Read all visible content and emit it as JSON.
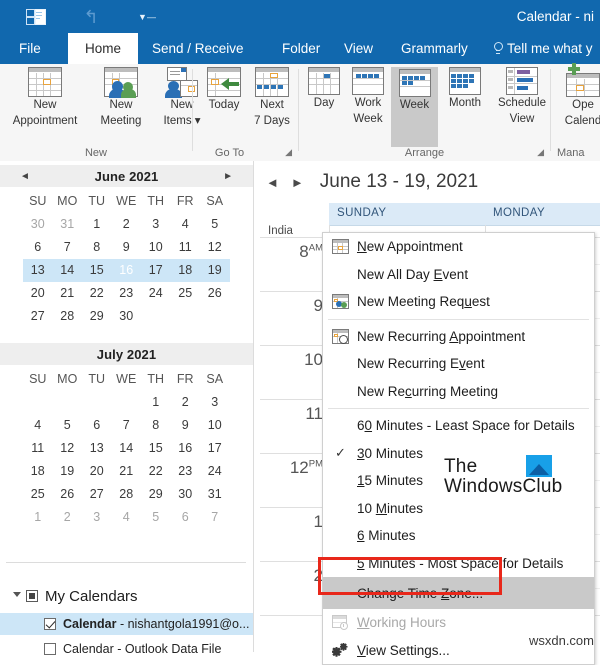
{
  "window": {
    "title": "Calendar - ni",
    "quick_access": [
      {
        "name": "outlook-icon",
        "label": "Outlook"
      },
      {
        "name": "undo-icon",
        "label": "Undo"
      },
      {
        "name": "customize-qat-icon",
        "label": "Customize Quick Access Toolbar"
      }
    ],
    "accent_color": "#1168ae"
  },
  "tabs": [
    {
      "label": "File",
      "active": false
    },
    {
      "label": "Home",
      "active": true
    },
    {
      "label": "Send / Receive",
      "active": false
    },
    {
      "label": "Folder",
      "active": false
    },
    {
      "label": "View",
      "active": false
    },
    {
      "label": "Grammarly",
      "active": false
    }
  ],
  "tell_me": "Tell me what y",
  "ribbon": {
    "groups": [
      {
        "name": "New",
        "label": "New",
        "has_launcher": false,
        "buttons": [
          {
            "label_line1": "New",
            "label_line2": "Appointment",
            "icon": "new-appointment-icon"
          },
          {
            "label_line1": "New",
            "label_line2": "Meeting",
            "icon": "new-meeting-icon"
          },
          {
            "label_line1": "New",
            "label_line2": "Items ▾",
            "icon": "new-items-icon"
          }
        ]
      },
      {
        "name": "GoTo",
        "label": "Go To",
        "has_launcher": true,
        "buttons": [
          {
            "label_line1": "Today",
            "label_line2": "",
            "icon": "today-icon"
          },
          {
            "label_line1": "Next",
            "label_line2": "7 Days",
            "icon": "next-7-days-icon"
          }
        ]
      },
      {
        "name": "Arrange",
        "label": "Arrange",
        "has_launcher": true,
        "buttons": [
          {
            "label_line1": "Day",
            "label_line2": "",
            "icon": "day-view-icon",
            "selected": false
          },
          {
            "label_line1": "Work",
            "label_line2": "Week",
            "icon": "work-week-icon",
            "selected": false
          },
          {
            "label_line1": "Week",
            "label_line2": "",
            "icon": "week-view-icon",
            "selected": true
          },
          {
            "label_line1": "Month",
            "label_line2": "",
            "icon": "month-view-icon",
            "selected": false
          },
          {
            "label_line1": "Schedule",
            "label_line2": "View",
            "icon": "schedule-view-icon",
            "selected": false
          }
        ]
      },
      {
        "name": "Manage",
        "label": "Mana",
        "has_launcher": false,
        "buttons": [
          {
            "label_line1": "Ope",
            "label_line2": "Calend",
            "icon": "open-calendar-icon"
          }
        ]
      }
    ]
  },
  "date_navigator": {
    "months": [
      {
        "title": "June 2021",
        "has_arrows": true,
        "prev_label": "◄",
        "next_label": "►",
        "dow": [
          "SU",
          "MO",
          "TU",
          "WE",
          "TH",
          "FR",
          "SA"
        ],
        "weeks": [
          [
            {
              "d": "30",
              "other": true
            },
            {
              "d": "31",
              "other": true
            },
            {
              "d": "1"
            },
            {
              "d": "2"
            },
            {
              "d": "3"
            },
            {
              "d": "4"
            },
            {
              "d": "5"
            }
          ],
          [
            {
              "d": "6"
            },
            {
              "d": "7"
            },
            {
              "d": "8"
            },
            {
              "d": "9"
            },
            {
              "d": "10"
            },
            {
              "d": "11"
            },
            {
              "d": "12"
            }
          ],
          [
            {
              "d": "13"
            },
            {
              "d": "14"
            },
            {
              "d": "15"
            },
            {
              "d": "16",
              "today": true
            },
            {
              "d": "17"
            },
            {
              "d": "18"
            },
            {
              "d": "19"
            }
          ],
          [
            {
              "d": "20"
            },
            {
              "d": "21"
            },
            {
              "d": "22"
            },
            {
              "d": "23"
            },
            {
              "d": "24"
            },
            {
              "d": "25"
            },
            {
              "d": "26"
            }
          ],
          [
            {
              "d": "27"
            },
            {
              "d": "28"
            },
            {
              "d": "29"
            },
            {
              "d": "30"
            },
            {
              "d": ""
            },
            {
              "d": ""
            },
            {
              "d": ""
            }
          ]
        ],
        "highlight_week": 2
      },
      {
        "title": "July 2021",
        "has_arrows": false,
        "dow": [
          "SU",
          "MO",
          "TU",
          "WE",
          "TH",
          "FR",
          "SA"
        ],
        "weeks": [
          [
            {
              "d": ""
            },
            {
              "d": ""
            },
            {
              "d": ""
            },
            {
              "d": ""
            },
            {
              "d": "1"
            },
            {
              "d": "2"
            },
            {
              "d": "3"
            }
          ],
          [
            {
              "d": "4"
            },
            {
              "d": "5"
            },
            {
              "d": "6"
            },
            {
              "d": "7"
            },
            {
              "d": "8"
            },
            {
              "d": "9"
            },
            {
              "d": "10"
            }
          ],
          [
            {
              "d": "11"
            },
            {
              "d": "12"
            },
            {
              "d": "13"
            },
            {
              "d": "14"
            },
            {
              "d": "15"
            },
            {
              "d": "16"
            },
            {
              "d": "17"
            }
          ],
          [
            {
              "d": "18"
            },
            {
              "d": "19"
            },
            {
              "d": "20"
            },
            {
              "d": "21"
            },
            {
              "d": "22"
            },
            {
              "d": "23"
            },
            {
              "d": "24"
            }
          ],
          [
            {
              "d": "25"
            },
            {
              "d": "26"
            },
            {
              "d": "27"
            },
            {
              "d": "28"
            },
            {
              "d": "29"
            },
            {
              "d": "30"
            },
            {
              "d": "31"
            }
          ],
          [
            {
              "d": "1",
              "other": true
            },
            {
              "d": "2",
              "other": true
            },
            {
              "d": "3",
              "other": true
            },
            {
              "d": "4",
              "other": true
            },
            {
              "d": "5",
              "other": true
            },
            {
              "d": "6",
              "other": true
            },
            {
              "d": "7",
              "other": true
            }
          ]
        ],
        "highlight_week": -1
      }
    ]
  },
  "my_calendars": {
    "title": "My Calendars",
    "items": [
      {
        "prefix": "Calendar",
        "suffix": " - nishantgola1991@o...",
        "checked": true,
        "selected": true
      },
      {
        "prefix": "",
        "suffix": "Calendar - Outlook Data File",
        "checked": false,
        "selected": false
      }
    ]
  },
  "calendar_view": {
    "prev_label": "◄",
    "next_label": "►",
    "title": "June 13 - 19, 2021",
    "day_headers": [
      "SUNDAY",
      "MONDAY"
    ],
    "timezone_label": "India",
    "hours": [
      {
        "num": "8",
        "ampm": "AM"
      },
      {
        "num": "9",
        "ampm": ""
      },
      {
        "num": "10",
        "ampm": ""
      },
      {
        "num": "11",
        "ampm": ""
      },
      {
        "num": "12",
        "ampm": "PM"
      },
      {
        "num": "1",
        "ampm": ""
      },
      {
        "num": "2",
        "ampm": ""
      }
    ]
  },
  "context_menu": {
    "items": [
      {
        "text": "New Appointment",
        "icon": "new-appointment-icon",
        "underline": "N",
        "type": "item"
      },
      {
        "text": "New All Day Event",
        "icon": "",
        "underline": "E",
        "type": "item"
      },
      {
        "text": "New Meeting Request",
        "icon": "new-meeting-request-icon",
        "underline": "u",
        "type": "item"
      },
      {
        "type": "separator"
      },
      {
        "text": "New Recurring Appointment",
        "icon": "new-recurring-icon",
        "underline": "A",
        "type": "item"
      },
      {
        "text": "New Recurring Event",
        "icon": "",
        "underline": "v",
        "type": "item"
      },
      {
        "text": "New Recurring Meeting",
        "icon": "",
        "underline": "c",
        "type": "item"
      },
      {
        "type": "separator"
      },
      {
        "text": "60 Minutes - Least Space for Details",
        "icon": "",
        "underline": "0",
        "type": "item"
      },
      {
        "text": "30 Minutes",
        "icon": "",
        "underline": "3",
        "type": "item",
        "checked": true
      },
      {
        "text": "15 Minutes",
        "icon": "",
        "underline": "1",
        "type": "item"
      },
      {
        "text": "10 Minutes",
        "icon": "",
        "underline": "M",
        "type": "item"
      },
      {
        "text": "6 Minutes",
        "icon": "",
        "underline": "6",
        "type": "item"
      },
      {
        "text": "5 Minutes - Most Space for Details",
        "icon": "",
        "underline": "5",
        "type": "item"
      },
      {
        "text": "Change Time Zone...",
        "icon": "",
        "underline": "Z",
        "type": "item",
        "highlighted": true
      },
      {
        "text": "Working Hours",
        "icon": "working-hours-icon",
        "underline": "W",
        "type": "item",
        "disabled": true
      },
      {
        "text": "View Settings...",
        "icon": "view-settings-icon",
        "underline": "V",
        "type": "item"
      }
    ],
    "highlight_color": "#e8271a"
  },
  "watermarks": {
    "logo_line1": "The",
    "logo_line2": "WindowsClub",
    "logo_accent": "#18a0e8",
    "corner_text": "wsxdn.com"
  }
}
